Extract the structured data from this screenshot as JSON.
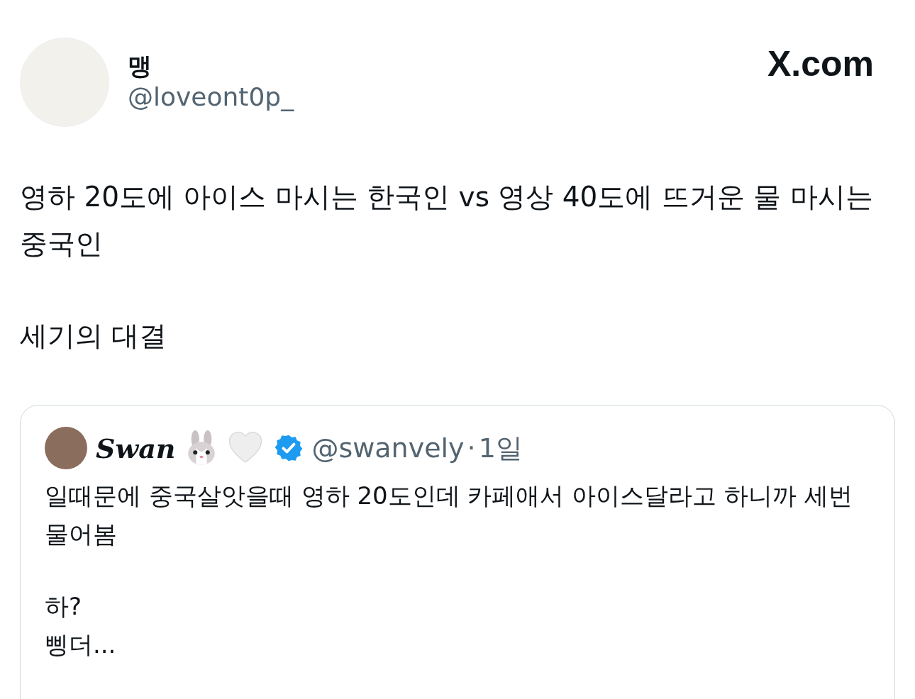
{
  "author": {
    "name": "맹",
    "handle": "@loveont0p_"
  },
  "site": "X.com",
  "body": [
    "영하 20도에 아이스 마시는 한국인 vs 영상 40도에 뜨거운 물 마시는 중국인",
    "세기의 대결"
  ],
  "quote": {
    "name": "Swan",
    "verified": true,
    "handle": "@swanvely",
    "separator": "·",
    "time": "1일",
    "paragraphs": [
      "일때문에 중국살앗을때 영하 20도인데 카페애서 아이스달라고 하니까 세번 물어봄",
      "하?\n삥더..."
    ]
  }
}
